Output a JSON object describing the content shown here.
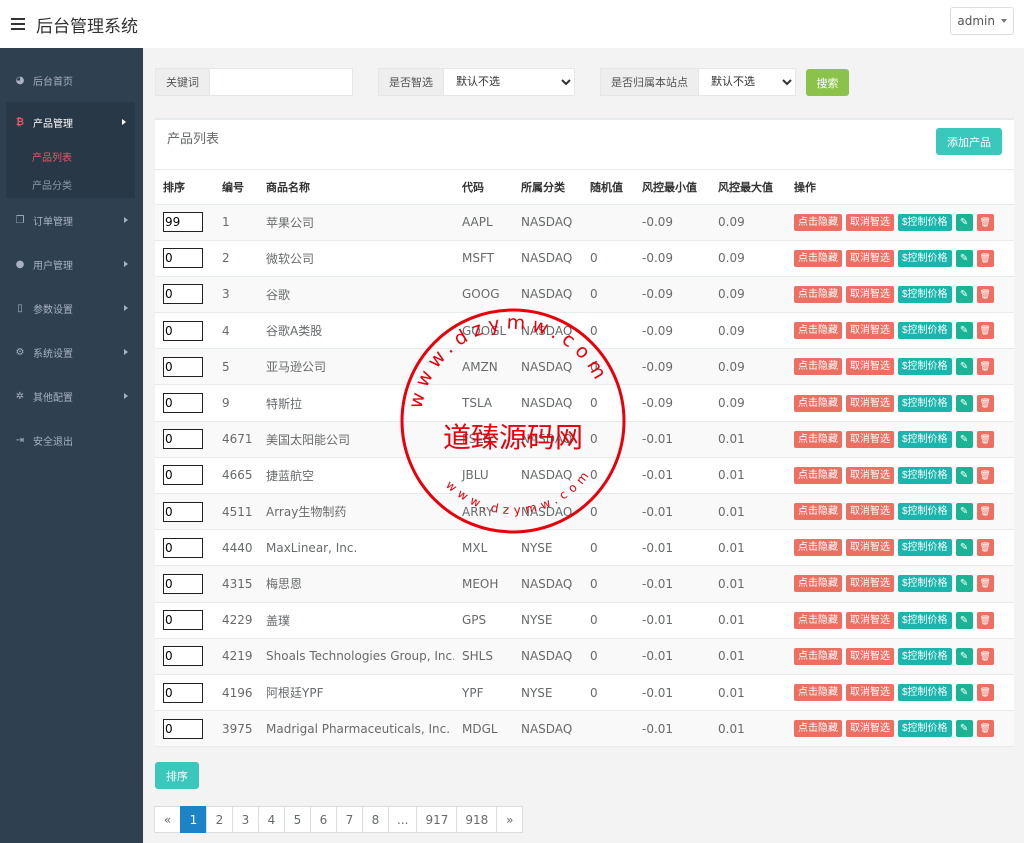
{
  "header": {
    "title": "后台管理系统",
    "user": "admin"
  },
  "sidebar": {
    "home": "后台首页",
    "product": {
      "label": "产品管理",
      "subs": [
        "产品列表",
        "产品分类"
      ]
    },
    "orders": "订单管理",
    "users": "用户管理",
    "params": "参数设置",
    "system": "系统设置",
    "other": "其他配置",
    "logout": "安全退出"
  },
  "search": {
    "keyword_label": "关键词",
    "keyword_value": "",
    "smart_label": "是否智选",
    "smart_value": "默认不选",
    "site_label": "是否归属本站点",
    "site_value": "默认不选",
    "button": "搜索"
  },
  "panel": {
    "title": "产品列表",
    "add_button": "添加产品"
  },
  "table": {
    "headers": [
      "排序",
      "编号",
      "商品名称",
      "代码",
      "所属分类",
      "随机值",
      "风控最小值",
      "风控最大值",
      "操作"
    ],
    "actions": {
      "hide": "点击隐藏",
      "unsmart": "取消智选",
      "price": "$控制价格"
    },
    "rows": [
      {
        "sort": "99",
        "id": "1",
        "name": "苹果公司",
        "code": "AAPL",
        "cat": "NASDAQ",
        "rand": "",
        "min": "-0.09",
        "max": "0.09"
      },
      {
        "sort": "0",
        "id": "2",
        "name": "微软公司",
        "code": "MSFT",
        "cat": "NASDAQ",
        "rand": "0",
        "min": "-0.09",
        "max": "0.09"
      },
      {
        "sort": "0",
        "id": "3",
        "name": "谷歌",
        "code": "GOOG",
        "cat": "NASDAQ",
        "rand": "0",
        "min": "-0.09",
        "max": "0.09"
      },
      {
        "sort": "0",
        "id": "4",
        "name": "谷歌A类股",
        "code": "GOOGL",
        "cat": "NASDAQ",
        "rand": "0",
        "min": "-0.09",
        "max": "0.09"
      },
      {
        "sort": "0",
        "id": "5",
        "name": "亚马逊公司",
        "code": "AMZN",
        "cat": "NASDAQ",
        "rand": "0",
        "min": "-0.09",
        "max": "0.09"
      },
      {
        "sort": "0",
        "id": "9",
        "name": "特斯拉",
        "code": "TSLA",
        "cat": "NASDAQ",
        "rand": "0",
        "min": "-0.09",
        "max": "0.09"
      },
      {
        "sort": "0",
        "id": "4671",
        "name": "美国太阳能公司",
        "code": "FSLR",
        "cat": "NASDAQ",
        "rand": "0",
        "min": "-0.01",
        "max": "0.01"
      },
      {
        "sort": "0",
        "id": "4665",
        "name": "捷蓝航空",
        "code": "JBLU",
        "cat": "NASDAQ",
        "rand": "0",
        "min": "-0.01",
        "max": "0.01"
      },
      {
        "sort": "0",
        "id": "4511",
        "name": "Array生物制药",
        "code": "ARRY",
        "cat": "NASDAQ",
        "rand": "0",
        "min": "-0.01",
        "max": "0.01"
      },
      {
        "sort": "0",
        "id": "4440",
        "name": "MaxLinear, Inc.",
        "code": "MXL",
        "cat": "NYSE",
        "rand": "0",
        "min": "-0.01",
        "max": "0.01"
      },
      {
        "sort": "0",
        "id": "4315",
        "name": "梅思恩",
        "code": "MEOH",
        "cat": "NASDAQ",
        "rand": "0",
        "min": "-0.01",
        "max": "0.01"
      },
      {
        "sort": "0",
        "id": "4229",
        "name": "盖璞",
        "code": "GPS",
        "cat": "NYSE",
        "rand": "0",
        "min": "-0.01",
        "max": "0.01"
      },
      {
        "sort": "0",
        "id": "4219",
        "name": "Shoals Technologies Group, Inc.",
        "code": "SHLS",
        "cat": "NASDAQ",
        "rand": "0",
        "min": "-0.01",
        "max": "0.01"
      },
      {
        "sort": "0",
        "id": "4196",
        "name": "阿根廷YPF",
        "code": "YPF",
        "cat": "NYSE",
        "rand": "0",
        "min": "-0.01",
        "max": "0.01"
      },
      {
        "sort": "0",
        "id": "3975",
        "name": "Madrigal Pharmaceuticals, Inc.",
        "code": "MDGL",
        "cat": "NASDAQ",
        "rand": "",
        "min": "-0.01",
        "max": "0.01"
      }
    ]
  },
  "sort_button": "排序",
  "pagination": [
    "«",
    "1",
    "2",
    "3",
    "4",
    "5",
    "6",
    "7",
    "8",
    "...",
    "917",
    "918",
    "»"
  ],
  "pagination_active": "1",
  "watermark": {
    "text": "道臻源码网",
    "url": "www.dzymw.com"
  },
  "colors": {
    "sidebar": "#2f4050",
    "accent_teal": "#3bc8bc",
    "danger": "#ed6f62",
    "active_page": "#1c84c6",
    "search_green": "#8bc34a"
  }
}
